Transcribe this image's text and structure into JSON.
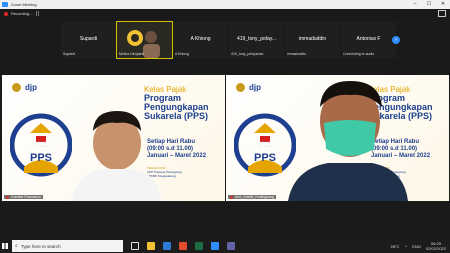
{
  "window": {
    "title": "Zoom Meeting",
    "minimize": "–",
    "maximize": "☐",
    "close": "✕"
  },
  "recording": {
    "label": "Recording..."
  },
  "participants_strip": [
    {
      "big_name": "Supardi",
      "label": "Supardi"
    },
    {
      "big_name": "",
      "label": "Melina Heriyanti"
    },
    {
      "big_name": "A Khiong",
      "label": "A Khiong"
    },
    {
      "big_name": "419_tony_pelay...",
      "label": "419_tony_pelayanan"
    },
    {
      "big_name": "immaduddin",
      "label": "immaduddin"
    },
    {
      "big_name": "Antonius F",
      "label": "Connecting to audio"
    }
  ],
  "tiles": [
    {
      "name": "Gumilar Rusmanyo"
    },
    {
      "name": "Arm_Arabitt_Kadingkang"
    }
  ],
  "slide": {
    "logo": "djp",
    "title1": "Kelas Pajak",
    "title2": "Program Pengungkapan Sukarela (PPS)",
    "schedule_day": "Setiap Hari Rabu",
    "schedule_time": "(09:00 s.d 11.00)",
    "schedule_period": "Januari – Maret 2022",
    "org_label": "PENGANTAR: ",
    "org1": "KPP Pratama Pandegiang",
    "org2": "KPKBP Kingkadalong",
    "pps_text": "PPS"
  },
  "taskbar": {
    "search_placeholder": "Type here to search",
    "temperature": "28°C",
    "language": "ENG",
    "time": "06:29",
    "date": "02/02/2022"
  },
  "colors": {
    "accent": "#2d8cff",
    "slide_blue": "#1d3f8f",
    "slide_gold": "#e6a400",
    "active_speaker": "#d8c200"
  }
}
